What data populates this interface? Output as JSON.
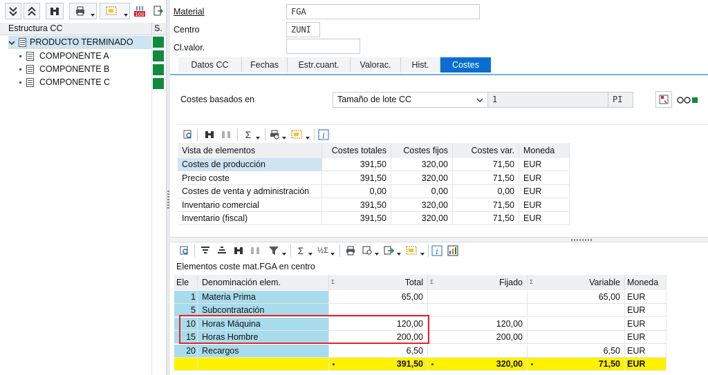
{
  "tree": {
    "header_label": "Estructura CC",
    "status_column_label": "S.",
    "items": [
      {
        "label": "PRODUCTO TERMINADO",
        "level": 0,
        "selected": true
      },
      {
        "label": "COMPONENTE A",
        "level": 1
      },
      {
        "label": "COMPONENTE B",
        "level": 1
      },
      {
        "label": "COMPONENTE C",
        "level": 1
      }
    ],
    "status_color": "#108a3c"
  },
  "header": {
    "material_label": "Material",
    "material_value": "FGA",
    "centro_label": "Centro",
    "centro_value": "ZUNI",
    "clvalor_label": "Cl.valor.",
    "clvalor_value": ""
  },
  "tabs": [
    {
      "label": "Datos CC"
    },
    {
      "label": "Fechas"
    },
    {
      "label": "Estr.cuant."
    },
    {
      "label": "Valorac."
    },
    {
      "label": "Hist."
    },
    {
      "label": "Costes",
      "active": true
    }
  ],
  "costs_based": {
    "label": "Costes basados en",
    "selected": "Tamaño de lote CC",
    "quantity": "1",
    "unit": "PI"
  },
  "summary": {
    "headers": [
      "Vista de elementos",
      "Costes totales",
      "Costes fijos",
      "Costes var.",
      "Moneda"
    ],
    "rows": [
      [
        "Costes de producción",
        "391,50",
        "320,00",
        "71,50",
        "EUR"
      ],
      [
        "Precio coste",
        "391,50",
        "320,00",
        "71,50",
        "EUR"
      ],
      [
        "Costes de venta y administración",
        "0,00",
        "0,00",
        "0,00",
        "EUR"
      ],
      [
        "Inventario comercial",
        "391,50",
        "320,00",
        "71,50",
        "EUR"
      ],
      [
        "Inventario (fiscal)",
        "391,50",
        "320,00",
        "71,50",
        "EUR"
      ]
    ]
  },
  "elements": {
    "title": "Elementos coste mat.FGA en centro",
    "sigma": "Σ",
    "headers": [
      "Ele",
      "Denominación elem.",
      "Total",
      "Fijado",
      "Variable",
      "Moneda"
    ],
    "rows": [
      [
        "1",
        "Materia Prima",
        "65,00",
        "",
        "65,00",
        "EUR"
      ],
      [
        "5",
        "Subcontratación",
        "",
        "",
        "",
        "EUR"
      ],
      [
        "10",
        "Horas Máquina",
        "120,00",
        "120,00",
        "",
        "EUR"
      ],
      [
        "15",
        "Horas Hombre",
        "200,00",
        "200,00",
        "",
        "EUR"
      ],
      [
        "20",
        "Recargos",
        "6,50",
        "",
        "6,50",
        "EUR"
      ]
    ],
    "totals": [
      "391,50",
      "320,00",
      "71,50",
      "EUR"
    ],
    "highlight_color": "#e8202a"
  },
  "toolbar_icons": [
    "collapse-all-icon",
    "expand-all-icon",
    "binoculars-icon",
    "print-icon",
    "layout-icon",
    "counter-icon",
    "export-icon"
  ]
}
